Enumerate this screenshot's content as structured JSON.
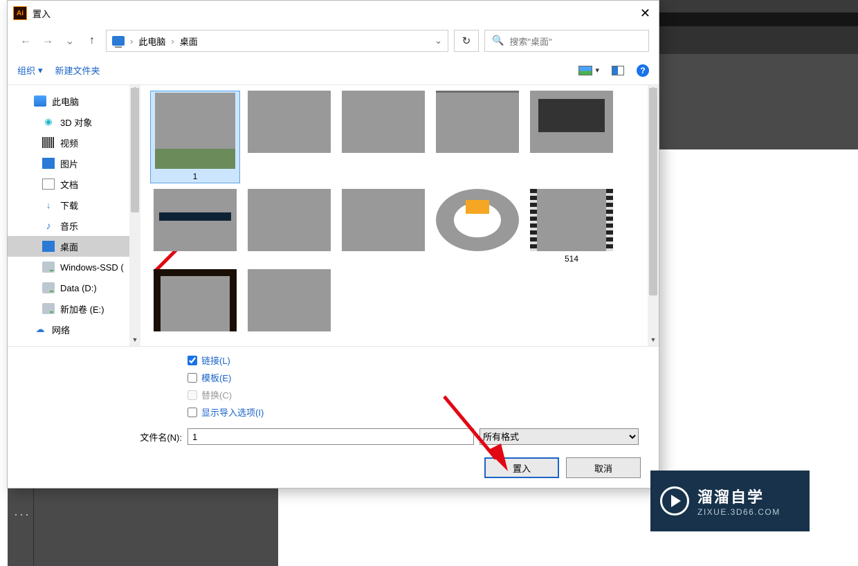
{
  "dialog": {
    "title": "置入",
    "breadcrumb": {
      "root": "此电脑",
      "current": "桌面"
    },
    "search_placeholder": "搜索\"桌面\"",
    "refresh_glyph": "↻",
    "toolbar": {
      "organize": "组织",
      "new_folder": "新建文件夹",
      "help_glyph": "?"
    },
    "sidebar": {
      "items": [
        {
          "label": "此电脑",
          "icon": "pc",
          "indent": false,
          "selected": false
        },
        {
          "label": "3D 对象",
          "icon": "cube",
          "indent": true,
          "selected": false
        },
        {
          "label": "视频",
          "icon": "vid",
          "indent": true,
          "selected": false
        },
        {
          "label": "图片",
          "icon": "img",
          "indent": true,
          "selected": false
        },
        {
          "label": "文档",
          "icon": "doc",
          "indent": true,
          "selected": false
        },
        {
          "label": "下载",
          "icon": "dl",
          "indent": true,
          "selected": false
        },
        {
          "label": "音乐",
          "icon": "mus",
          "indent": true,
          "selected": false
        },
        {
          "label": "桌面",
          "icon": "desk",
          "indent": true,
          "selected": true
        },
        {
          "label": "Windows-SSD (",
          "icon": "drive",
          "indent": true,
          "selected": false
        },
        {
          "label": "Data (D:)",
          "icon": "drive",
          "indent": true,
          "selected": false
        },
        {
          "label": "新加卷 (E:)",
          "icon": "drive",
          "indent": true,
          "selected": false
        },
        {
          "label": "网络",
          "icon": "net",
          "indent": false,
          "selected": false
        }
      ]
    },
    "files": [
      {
        "label": "1",
        "thumb": "hikers",
        "selected": true
      },
      {
        "label": "",
        "thumb": "ai",
        "selected": false
      },
      {
        "label": "",
        "thumb": "dark",
        "selected": false
      },
      {
        "label": "",
        "thumb": "dark2",
        "selected": false
      },
      {
        "label": "",
        "thumb": "panel",
        "selected": false
      },
      {
        "label": "",
        "thumb": "ps",
        "selected": false
      },
      {
        "label": "",
        "thumb": "pix1",
        "selected": false
      },
      {
        "label": "",
        "thumb": "pix2",
        "selected": false
      },
      {
        "label": "",
        "thumb": "logo",
        "selected": false
      },
      {
        "label": "514",
        "thumb": "vid",
        "selected": false
      },
      {
        "label": "",
        "thumb": "aiicon",
        "selected": false
      },
      {
        "label": "",
        "thumb": "folder",
        "selected": false
      }
    ],
    "options": {
      "link": {
        "label": "链接(L)",
        "checked": true,
        "disabled": false
      },
      "template": {
        "label": "模板(E)",
        "checked": false,
        "disabled": false
      },
      "replace": {
        "label": "替换(C)",
        "checked": false,
        "disabled": true
      },
      "show_import": {
        "label": "显示导入选项(I)",
        "checked": false,
        "disabled": false
      }
    },
    "filename_prompt": "文件名(N):",
    "filename_value": "1",
    "filetype_value": "所有格式",
    "buttons": {
      "place": "置入",
      "cancel": "取消"
    }
  },
  "watermark": {
    "line1": "溜溜自学",
    "line2": "ZIXUE.3D66.COM"
  }
}
